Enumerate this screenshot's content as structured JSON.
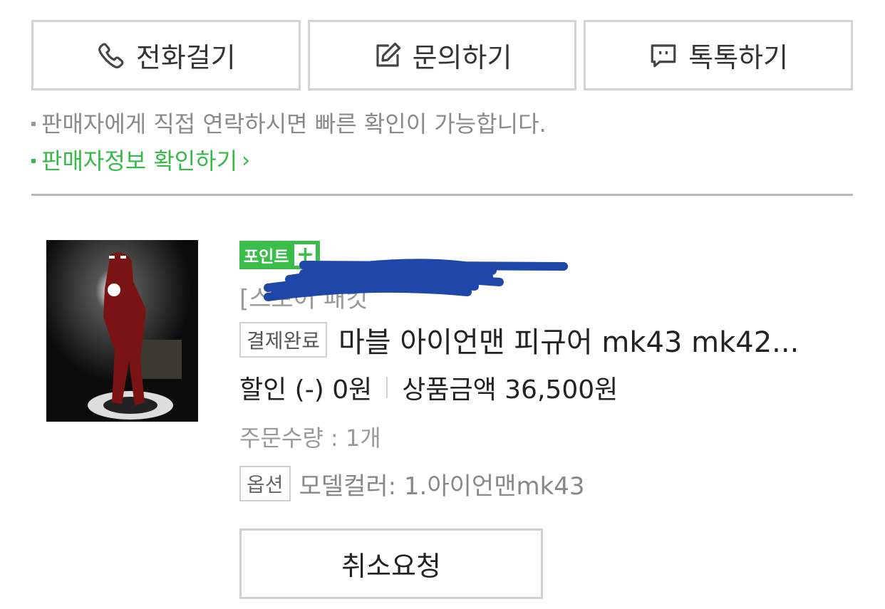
{
  "actions": {
    "call_label": "전화걸기",
    "inquiry_label": "문의하기",
    "talk_label": "톡톡하기"
  },
  "notes": {
    "contact_note": "판매자에게 직접 연락하시면 빠른 확인이 가능합니다.",
    "seller_info_link": "판매자정보 확인하기",
    "chevron": "›"
  },
  "order": {
    "point_badge": "포인트",
    "point_plus": "+",
    "store_name": "[스토어 패킷",
    "status": "결제완료",
    "product_name": "마블 아이언맨 피규어 mk43 mk42...",
    "discount": "할인 (-) 0원",
    "product_amount": "상품금액 36,500원",
    "quantity": "주문수량 : 1개",
    "option_tag": "옵션",
    "option_value": "모델컬러: 1.아이언맨mk43",
    "cancel_label": "취소요청"
  },
  "colors": {
    "accent_green": "#3bbd4b",
    "redaction_blue": "#1e47a8"
  },
  "icons": [
    "phone-icon",
    "edit-icon",
    "chat-icon",
    "chevron-right-icon",
    "plus-icon"
  ]
}
